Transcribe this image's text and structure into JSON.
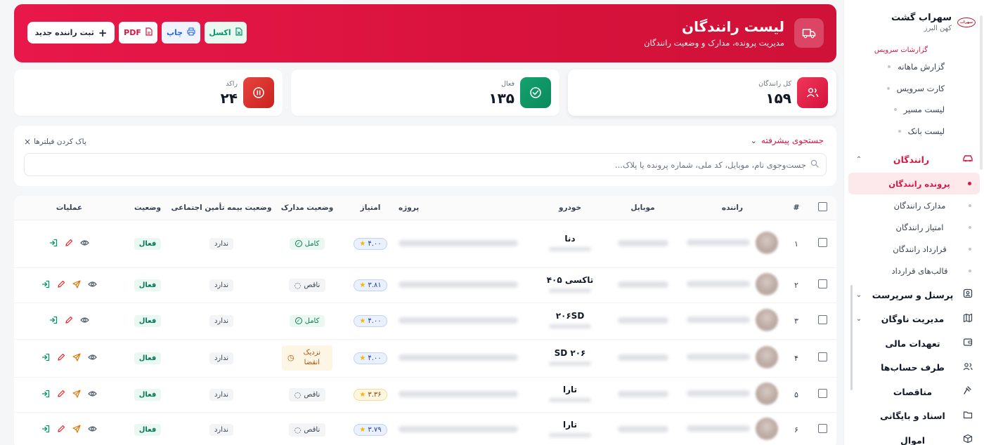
{
  "brand": {
    "name": "سهراب گشت",
    "sub": "کهن البرز",
    "logo_text": "سهراب"
  },
  "sidebar": {
    "section_reports": "گزارشات سرویس",
    "reports": [
      "گزارش ماهانه",
      "کارت سرویس",
      "لیست مسیر",
      "لیست بانک"
    ],
    "drivers_group": "رانندگان",
    "drivers_items": [
      "پرونده رانندگان",
      "مدارک رانندگان",
      "امتیاز رانندگان",
      "قرارداد رانندگان",
      "قالب‌های قرارداد"
    ],
    "nav": [
      {
        "label": "پرسنل و سرپرست",
        "icon": "id-card-icon",
        "chevron": true
      },
      {
        "label": "مدیریت ناوگان",
        "icon": "map-icon",
        "chevron": true
      },
      {
        "label": "تعهدات مالی",
        "icon": "wallet-icon",
        "chevron": false
      },
      {
        "label": "طرف حساب‌ها",
        "icon": "users-icon",
        "chevron": false
      },
      {
        "label": "مناقصات",
        "icon": "gavel-icon",
        "chevron": false
      },
      {
        "label": "اسناد و بایگانی",
        "icon": "folder-icon",
        "chevron": false
      },
      {
        "label": "اموال",
        "icon": "box-icon",
        "chevron": false
      }
    ]
  },
  "header": {
    "title": "لیست رانندگان",
    "subtitle": "مدیریت پرونده، مدارک و وضعیت رانندگان",
    "new_driver": "ثبت راننده جدید",
    "pdf": "PDF",
    "print": "چاپ",
    "excel": "اکسل"
  },
  "stats": {
    "total_label": "کل رانندگان",
    "total_value": "۱۵۹",
    "active_label": "فعال",
    "active_value": "۱۳۵",
    "idle_label": "راکد",
    "idle_value": "۲۴"
  },
  "filters": {
    "advanced": "جستجوی پیشرفته",
    "clear": "پاک کردن فیلترها",
    "search_placeholder": "جست‌وجوی نام، موبایل، کد ملی، شماره پرونده یا پلاک..."
  },
  "table": {
    "columns": [
      "#",
      "راننده",
      "موبایل",
      "خودرو",
      "پروژه",
      "امتیاز",
      "وضعیت مدارک",
      "وضعیت بیمه تأمین اجتماعی",
      "وضعیت",
      "عملیات"
    ],
    "rows": [
      {
        "num": "۱",
        "car": "دنا",
        "score": "۴.۰۰",
        "score_warn": false,
        "doc": "کامل",
        "doc_type": "ok",
        "insurance": "ندارد",
        "status": "فعال",
        "send": false
      },
      {
        "num": "۲",
        "car": "تاکسی ۴۰۵",
        "score": "۳.۸۱",
        "score_warn": false,
        "doc": "ناقص",
        "doc_type": "bad",
        "insurance": "ندارد",
        "status": "فعال",
        "send": true
      },
      {
        "num": "۳",
        "car": "۲۰۶SD",
        "score": "۴.۰۰",
        "score_warn": false,
        "doc": "کامل",
        "doc_type": "ok",
        "insurance": "ندارد",
        "status": "فعال",
        "send": false
      },
      {
        "num": "۴",
        "car": "SD ۲۰۶",
        "score": "۴.۰۰",
        "score_warn": false,
        "doc": "نزدیک انقضا",
        "doc_type": "near",
        "insurance": "ندارد",
        "status": "فعال",
        "send": true
      },
      {
        "num": "۵",
        "car": "تارا",
        "score": "۳.۳۶",
        "score_warn": true,
        "doc": "ناقص",
        "doc_type": "bad",
        "insurance": "ندارد",
        "status": "فعال",
        "send": true
      },
      {
        "num": "۶",
        "car": "تارا",
        "score": "۳.۷۹",
        "score_warn": false,
        "doc": "ناقص",
        "doc_type": "bad",
        "insurance": "ندارد",
        "status": "فعال",
        "send": true
      }
    ]
  },
  "colors": {
    "accent": "#d9163f",
    "success": "#059669",
    "idle": "#dc2626"
  }
}
